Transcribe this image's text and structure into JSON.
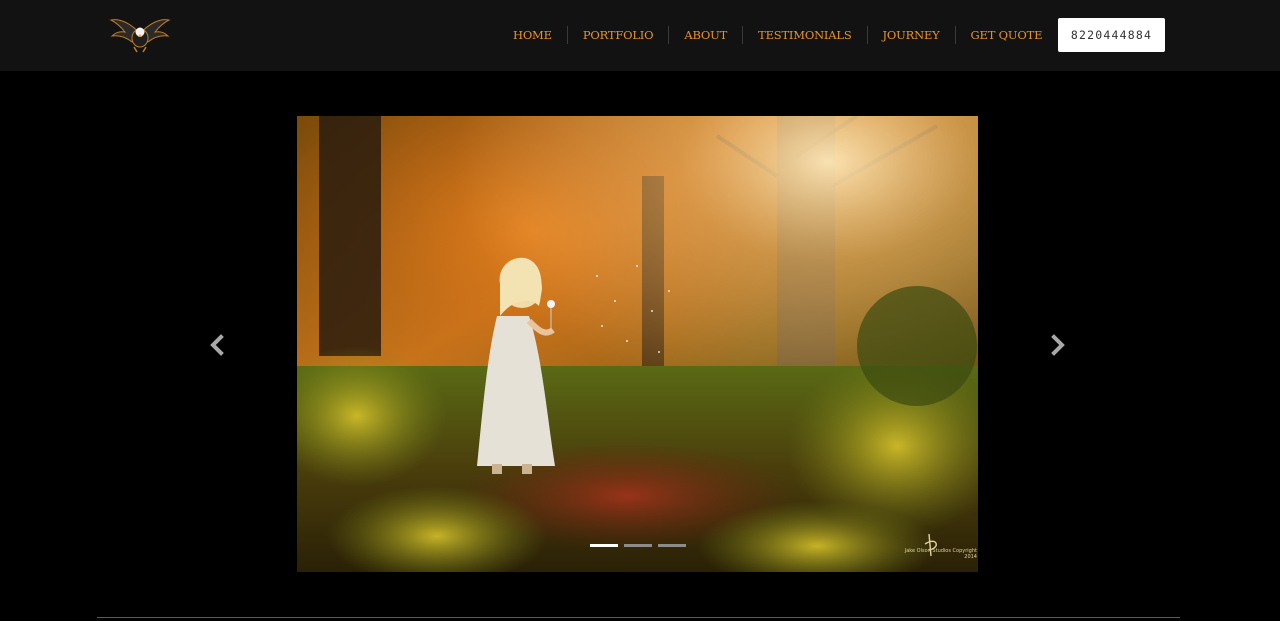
{
  "header": {
    "logo_icon": "eagle-logo-icon",
    "nav": [
      {
        "label": "HOME"
      },
      {
        "label": "PORTFOLIO"
      },
      {
        "label": "ABOUT"
      },
      {
        "label": "TESTIMONIALS"
      },
      {
        "label": "JOURNEY"
      },
      {
        "label": "GET QUOTE"
      }
    ],
    "phone": "8220444884"
  },
  "carousel": {
    "prev_icon": "chevron-left-icon",
    "next_icon": "chevron-right-icon",
    "active_index": 0,
    "slide_count": 3,
    "watermark": "Jake Olson Studios Copyright 2014"
  },
  "colors": {
    "nav_text": "#e8922a",
    "header_bg": "#121212",
    "page_bg": "#000000"
  }
}
